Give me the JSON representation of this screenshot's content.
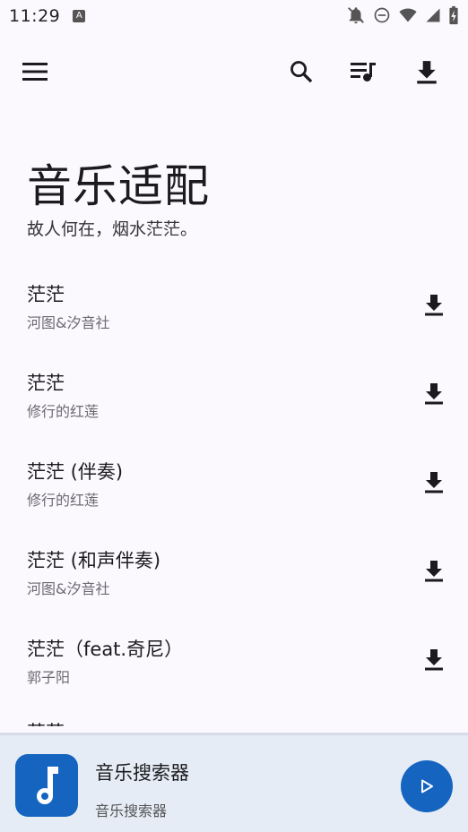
{
  "status_bar": {
    "time": "11:29",
    "notification_icon": "a-icon"
  },
  "header": {
    "title": "音乐适配",
    "subtitle": "故人何在，烟水茫茫。"
  },
  "songs": [
    {
      "title": "茫茫",
      "artist": "河图&汐音社"
    },
    {
      "title": "茫茫",
      "artist": "修行的红莲"
    },
    {
      "title": "茫茫 (伴奏)",
      "artist": "修行的红莲"
    },
    {
      "title": "茫茫 (和声伴奏)",
      "artist": "河图&汐音社"
    },
    {
      "title": "茫茫（feat.奇尼）",
      "artist": "郭子阳"
    },
    {
      "title": "茫茫",
      "artist": ""
    }
  ],
  "player": {
    "title": "音乐搜索器",
    "subtitle": "音乐搜索器"
  },
  "colors": {
    "accent": "#1565c0",
    "background": "#fbf8fe",
    "player_background": "#e6ecf6"
  }
}
